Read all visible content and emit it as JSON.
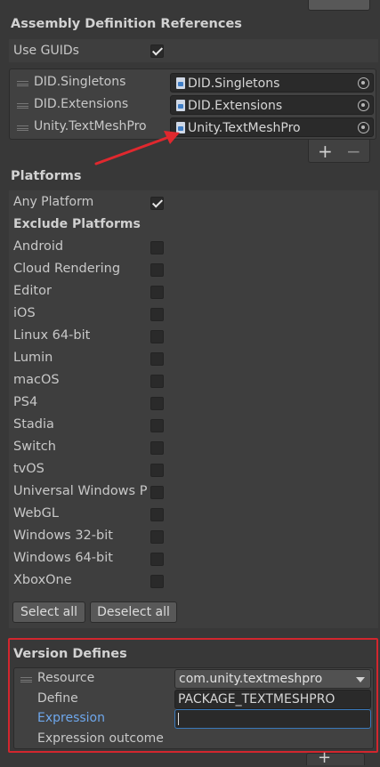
{
  "assembly_refs": {
    "header": "Assembly Definition References",
    "use_guids_label": "Use GUIDs",
    "use_guids_checked": true,
    "items": [
      {
        "label": "DID.Singletons",
        "value": "DID.Singletons"
      },
      {
        "label": "DID.Extensions",
        "value": "DID.Extensions"
      },
      {
        "label": "Unity.TextMeshPro",
        "value": "Unity.TextMeshPro"
      }
    ],
    "add_label": "+",
    "remove_label": "−"
  },
  "platforms": {
    "header": "Platforms",
    "any_platform_label": "Any Platform",
    "any_platform_checked": true,
    "exclude_header": "Exclude Platforms",
    "items": [
      {
        "label": "Android",
        "checked": false
      },
      {
        "label": "Cloud Rendering",
        "checked": false
      },
      {
        "label": "Editor",
        "checked": false
      },
      {
        "label": "iOS",
        "checked": false
      },
      {
        "label": "Linux 64-bit",
        "checked": false
      },
      {
        "label": "Lumin",
        "checked": false
      },
      {
        "label": "macOS",
        "checked": false
      },
      {
        "label": "PS4",
        "checked": false
      },
      {
        "label": "Stadia",
        "checked": false
      },
      {
        "label": "Switch",
        "checked": false
      },
      {
        "label": "tvOS",
        "checked": false
      },
      {
        "label": "Universal Windows P",
        "checked": false
      },
      {
        "label": "WebGL",
        "checked": false
      },
      {
        "label": "Windows 32-bit",
        "checked": false
      },
      {
        "label": "Windows 64-bit",
        "checked": false
      },
      {
        "label": "XboxOne",
        "checked": false
      }
    ],
    "select_all_label": "Select all",
    "deselect_all_label": "Deselect all"
  },
  "version_defines": {
    "header": "Version Defines",
    "resource_label": "Resource",
    "resource_value": "com.unity.textmeshpro",
    "define_label": "Define",
    "define_value": "PACKAGE_TEXTMESHPRO",
    "expression_label": "Expression",
    "expression_value": "",
    "outcome_label": "Expression outcome",
    "add_label": "+"
  },
  "colors": {
    "highlight_box": "#d2262e",
    "arrow": "#e0282e",
    "expression_label": "#6ea7ec",
    "focus_border": "#3a79bb"
  }
}
